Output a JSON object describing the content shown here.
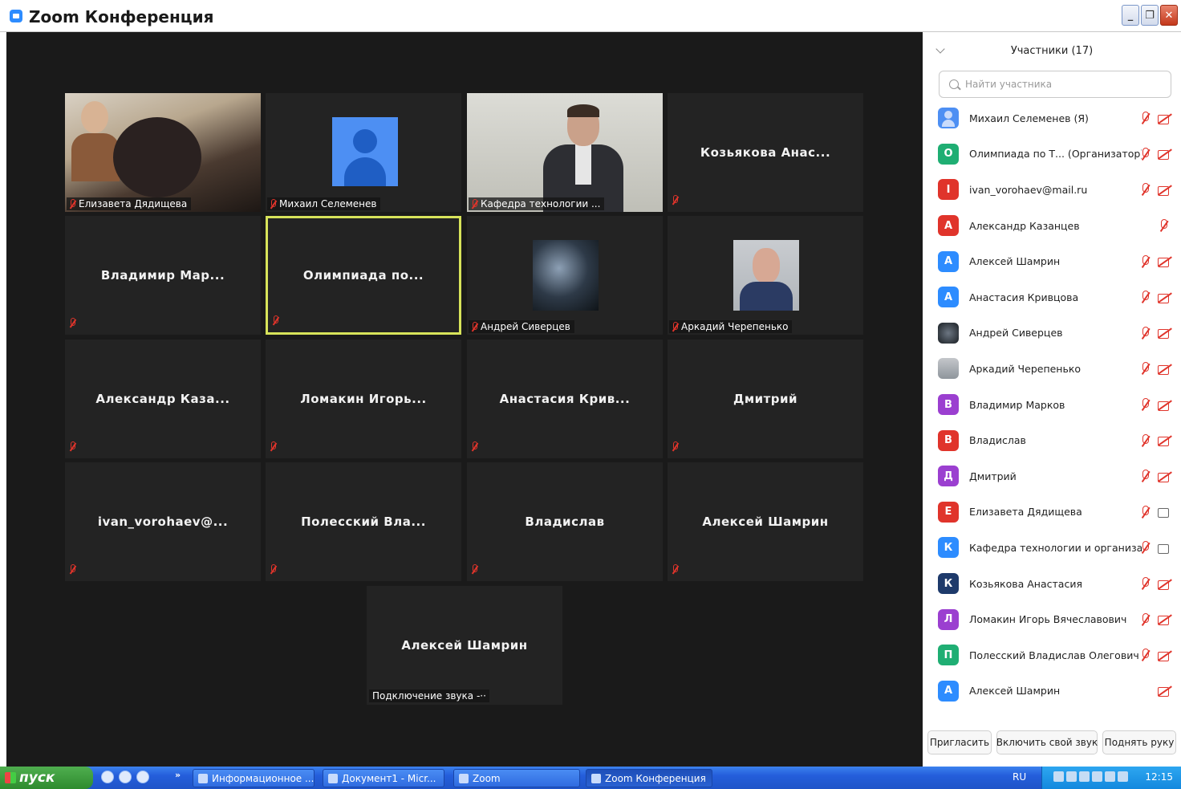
{
  "window": {
    "title": "Zoom Конференция"
  },
  "video_tiles": [
    {
      "name": "Елизавета Дядищева",
      "kind": "photo1",
      "muted": true
    },
    {
      "name": "Михаил Селеменев",
      "kind": "avatar",
      "muted": true
    },
    {
      "name": "Кафедра технологии ...",
      "kind": "photo3",
      "muted": true
    },
    {
      "name": "Козьякова Анас...",
      "kind": "text",
      "muted": true
    },
    {
      "name": "Владимир Мар...",
      "kind": "text",
      "muted": true
    },
    {
      "name": "Олимпиада по...",
      "kind": "text",
      "muted": true,
      "active": true
    },
    {
      "name": "Андрей Сиверцев",
      "kind": "game",
      "muted": true
    },
    {
      "name": "Аркадий Черепенько",
      "kind": "man",
      "muted": true
    },
    {
      "name": "Александр Каза...",
      "kind": "text",
      "muted": true
    },
    {
      "name": "Ломакин Игорь...",
      "kind": "text",
      "muted": true
    },
    {
      "name": "Анастасия Крив...",
      "kind": "text",
      "muted": true
    },
    {
      "name": "Дмитрий",
      "kind": "text",
      "muted": true
    },
    {
      "name": "ivan_vorohaev@...",
      "kind": "text",
      "muted": true
    },
    {
      "name": "Полесский Вла...",
      "kind": "text",
      "muted": true
    },
    {
      "name": "Владислав",
      "kind": "text",
      "muted": true
    },
    {
      "name": "Алексей Шамрин",
      "kind": "text",
      "muted": true
    },
    {
      "name": "Алексей Шамрин",
      "kind": "connecting",
      "muted": false,
      "status": "Подключение звука -··"
    }
  ],
  "panel": {
    "title": "Участники (17)",
    "search_placeholder": "Найти участника",
    "participants": [
      {
        "initial": "",
        "avatar": "user",
        "color": "#4d8ff3",
        "name": "Михаил Селеменев (Я)",
        "mic": true,
        "cam": "off"
      },
      {
        "initial": "О",
        "color": "#1fae73",
        "name": "Олимпиада по Т...  (Организатор)",
        "mic": true,
        "cam": "off"
      },
      {
        "initial": "I",
        "color": "#e0342b",
        "name": "ivan_vorohaev@mail.ru",
        "mic": true,
        "cam": "off"
      },
      {
        "initial": "А",
        "color": "#e0342b",
        "name": "Александр Казанцев",
        "mic": true,
        "cam": "none"
      },
      {
        "initial": "А",
        "color": "#2d8cff",
        "name": "Алексей Шамрин",
        "mic": true,
        "cam": "off"
      },
      {
        "initial": "А",
        "color": "#2d8cff",
        "name": "Анастасия Кривцова",
        "mic": true,
        "cam": "off"
      },
      {
        "initial": "",
        "avatar": "game",
        "color": "#333333",
        "name": "Андрей Сиверцев",
        "mic": true,
        "cam": "off"
      },
      {
        "initial": "",
        "avatar": "man",
        "color": "#999999",
        "name": "Аркадий Черепенько",
        "mic": true,
        "cam": "off"
      },
      {
        "initial": "В",
        "color": "#9b3fd0",
        "name": "Владимир Марков",
        "mic": true,
        "cam": "off"
      },
      {
        "initial": "В",
        "color": "#e0342b",
        "name": "Владислав",
        "mic": true,
        "cam": "off"
      },
      {
        "initial": "Д",
        "color": "#9b3fd0",
        "name": "Дмитрий",
        "mic": true,
        "cam": "off"
      },
      {
        "initial": "Е",
        "color": "#e0342b",
        "name": "Елизавета Дядищева",
        "mic": true,
        "cam": "on"
      },
      {
        "initial": "К",
        "color": "#2d8cff",
        "name": "Кафедра технологии и организа...",
        "mic": true,
        "cam": "on"
      },
      {
        "initial": "К",
        "color": "#1e3a6b",
        "name": "Козьякова Анастасия",
        "mic": true,
        "cam": "off"
      },
      {
        "initial": "Л",
        "color": "#9b3fd0",
        "name": "Ломакин Игорь Вячеславович",
        "mic": true,
        "cam": "off"
      },
      {
        "initial": "П",
        "color": "#1fae73",
        "name": "Полесский Владислав Олегович",
        "mic": true,
        "cam": "off"
      },
      {
        "initial": "А",
        "color": "#2d8cff",
        "name": "Алексей Шамрин",
        "mic": false,
        "cam": "off"
      }
    ],
    "footer": {
      "invite": "Пригласить",
      "unmute": "Включить свой звук",
      "raise_hand": "Поднять руку"
    }
  },
  "taskbar": {
    "start": "пуск",
    "chevron": "»",
    "buttons": [
      {
        "label": "Информационное ..."
      },
      {
        "label": "Документ1 - Micr..."
      },
      {
        "label": "Zoom"
      },
      {
        "label": "Zoom Конференция",
        "active": true
      }
    ],
    "language": "RU",
    "time": "12:15"
  }
}
